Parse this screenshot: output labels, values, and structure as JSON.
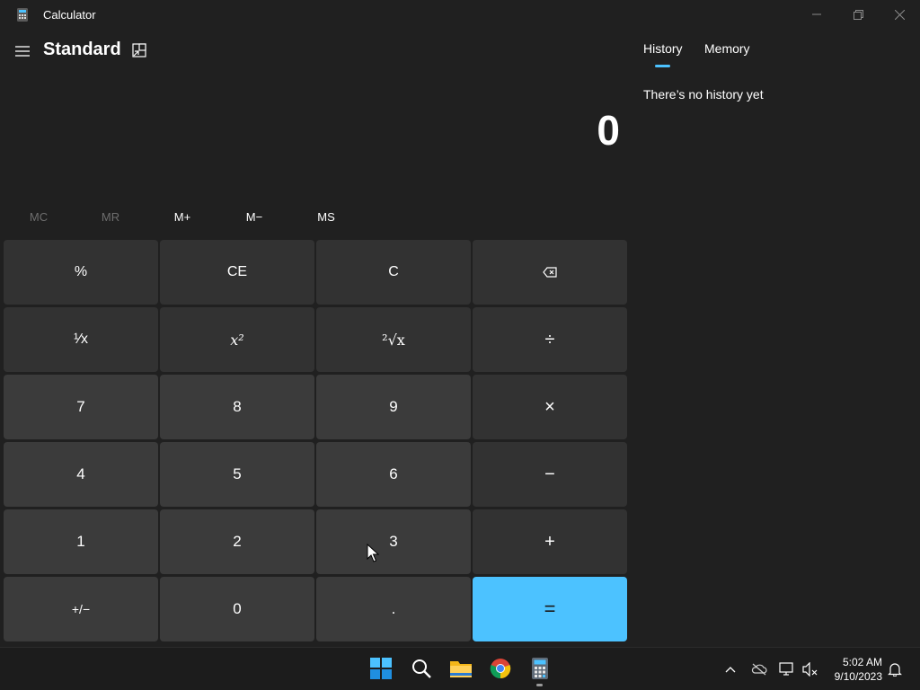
{
  "window": {
    "title": "Calculator",
    "app_icon": "calculator-icon",
    "controls": [
      "minimize-icon",
      "maximize-icon",
      "close-icon"
    ]
  },
  "header": {
    "menu_icon": "hamburger-icon",
    "mode": "Standard",
    "keep_on_top_icon": "keep-on-top-icon"
  },
  "display": {
    "value": "0"
  },
  "memory": {
    "buttons": [
      {
        "label": "MC",
        "enabled": false
      },
      {
        "label": "MR",
        "enabled": false
      },
      {
        "label": "M+",
        "enabled": true
      },
      {
        "label": "M−",
        "enabled": true
      },
      {
        "label": "MS",
        "enabled": true
      }
    ]
  },
  "keypad": {
    "rows": [
      [
        "%",
        "CE",
        "C",
        "⌫"
      ],
      [
        "¹⁄x",
        "x²",
        "²√x",
        "÷"
      ],
      [
        "7",
        "8",
        "9",
        "×"
      ],
      [
        "4",
        "5",
        "6",
        "−"
      ],
      [
        "1",
        "2",
        "3",
        "+"
      ],
      [
        "+/−",
        "0",
        ".",
        "="
      ]
    ]
  },
  "side_panel": {
    "tabs": [
      "History",
      "Memory"
    ],
    "active_tab": "History",
    "empty_message": "There’s no history yet"
  },
  "taskbar": {
    "apps": [
      "windows-start-icon",
      "search-icon",
      "file-explorer-icon",
      "chrome-icon",
      "calculator-icon"
    ],
    "active_app": "calculator-icon",
    "tray": [
      "chevron-up-icon",
      "onedrive-icon",
      "network-icon",
      "volume-muted-icon"
    ],
    "time": "5:02 AM",
    "date": "9/10/2023",
    "notification_icon": "bell-icon"
  },
  "colors": {
    "background": "#202020",
    "accent": "#4cc2ff",
    "function_key": "#323232",
    "number_key": "#3b3b3b",
    "taskbar": "#1c1c1c"
  }
}
